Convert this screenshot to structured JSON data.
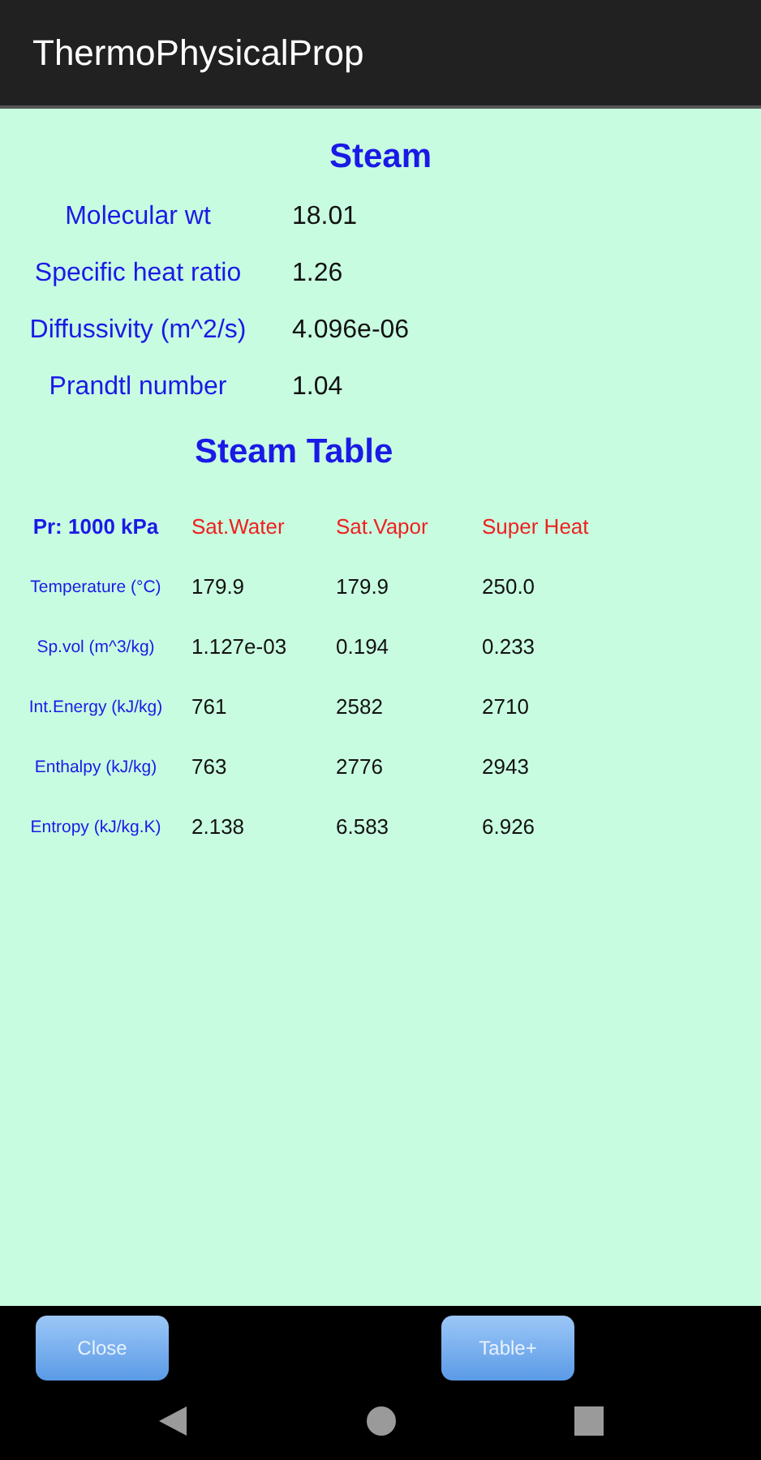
{
  "app_bar": {
    "title": "ThermoPhysicalProp"
  },
  "substance": {
    "title": "Steam"
  },
  "properties": [
    {
      "label": "Molecular wt",
      "value": "18.01"
    },
    {
      "label": "Specific heat ratio",
      "value": "1.26"
    },
    {
      "label": "Diffussivity (m^2/s)",
      "value": "4.096e-06"
    },
    {
      "label": "Prandtl number",
      "value": "1.04"
    }
  ],
  "steam_table": {
    "title": "Steam Table",
    "pressure": "Pr: 1000 kPa",
    "columns": [
      "Sat.Water",
      "Sat.Vapor",
      "Super Heat"
    ],
    "rows": [
      {
        "label": "Temperature (°C)",
        "values": [
          "179.9",
          "179.9",
          "250.0"
        ]
      },
      {
        "label": "Sp.vol (m^3/kg)",
        "values": [
          "1.127e-03",
          "0.194",
          "0.233"
        ]
      },
      {
        "label": "Int.Energy (kJ/kg)",
        "values": [
          "761",
          "2582",
          "2710"
        ]
      },
      {
        "label": "Enthalpy (kJ/kg)",
        "values": [
          "763",
          "2776",
          "2943"
        ]
      },
      {
        "label": "Entropy (kJ/kg.K)",
        "values": [
          "2.138",
          "6.583",
          "6.926"
        ]
      }
    ]
  },
  "buttons": [
    "Close",
    "Table+"
  ]
}
